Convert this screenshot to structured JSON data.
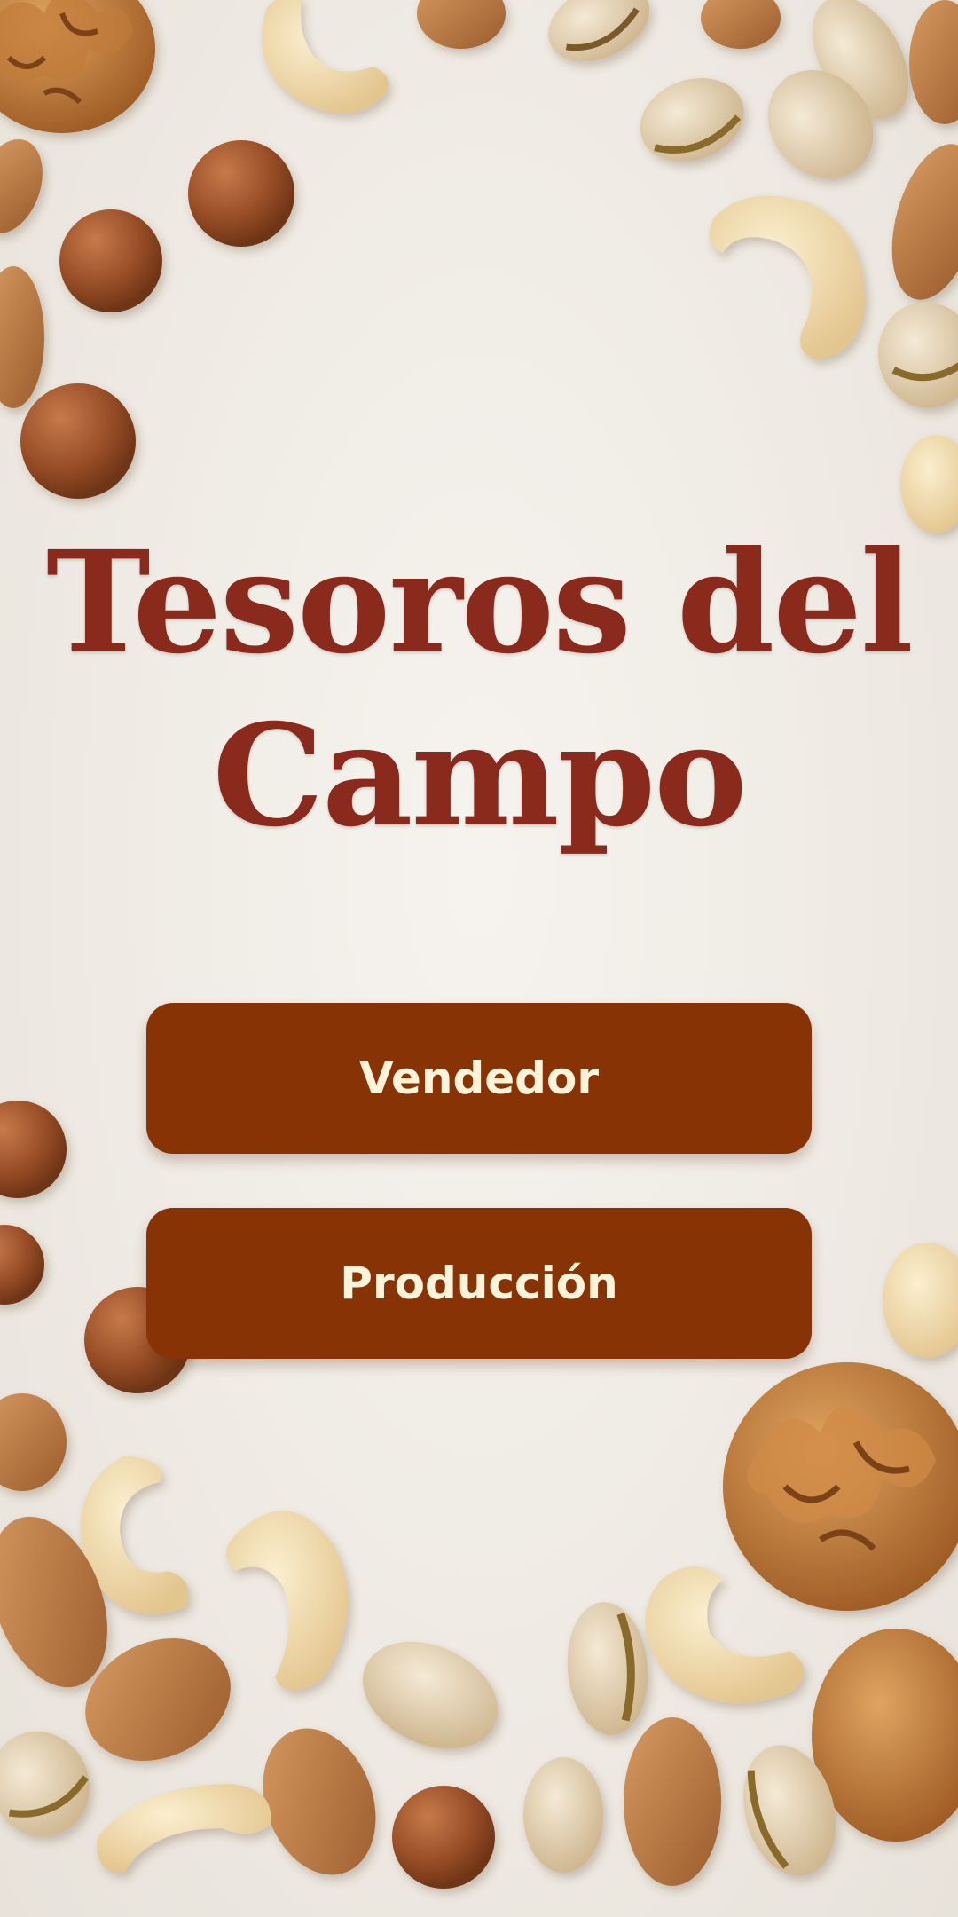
{
  "app": {
    "title_line1": "Tesoros del",
    "title_line2": "Campo"
  },
  "buttons": {
    "vendedor_label": "Vendedor",
    "produccion_label": "Producción"
  },
  "colors": {
    "title": "#8a2a1c",
    "button_bg": "#873306",
    "button_text": "#fbf3da",
    "background": "#efebe4"
  },
  "background_image": {
    "theme": "mixed nuts: walnuts, cashews, almonds, hazelnuts, pistachios"
  }
}
